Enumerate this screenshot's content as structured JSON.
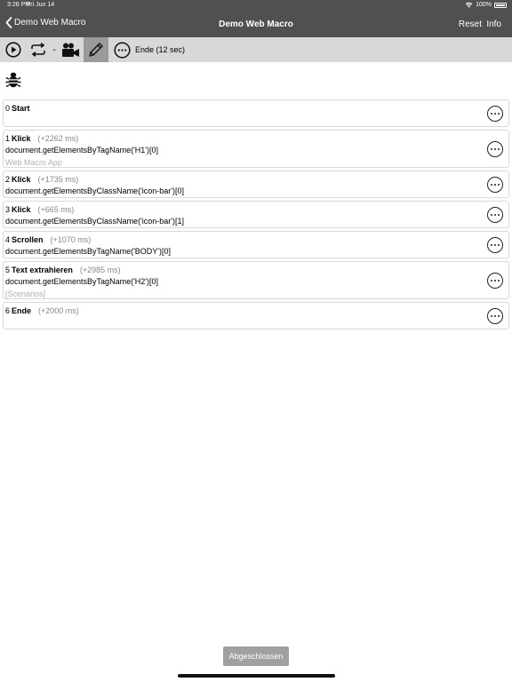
{
  "status_bar": {
    "time": "3:26 PM",
    "date": "Fri Jun 14",
    "battery": "100%"
  },
  "nav": {
    "back_label": "Demo Web Macro",
    "title": "Demo Web Macro",
    "reset_label": "Reset",
    "info_label": "Info"
  },
  "toolbar": {
    "dash": "-",
    "status": "Ende (12 sec)"
  },
  "steps": [
    {
      "number": "0",
      "name": "Start",
      "delay": "",
      "selector": "",
      "note": ""
    },
    {
      "number": "1",
      "name": "Klick",
      "delay": "(+2262 ms)",
      "selector": "document.getElementsByTagName('H1')[0]",
      "note": "Web Macro App"
    },
    {
      "number": "2",
      "name": "Klick",
      "delay": "(+1735 ms)",
      "selector": "document.getElementsByClassName('icon-bar')[0]",
      "note": ""
    },
    {
      "number": "3",
      "name": "Klick",
      "delay": "(+665 ms)",
      "selector": "document.getElementsByClassName('icon-bar')[1]",
      "note": ""
    },
    {
      "number": "4",
      "name": "Scrollen",
      "delay": "(+1070 ms)",
      "selector": "document.getElementsByTagName('BODY')[0]",
      "note": ""
    },
    {
      "number": "5",
      "name": "Text extrahieren",
      "delay": "(+2985 ms)",
      "selector": "document.getElementsByTagName('H2')[0]",
      "note": "[Scenarios]"
    },
    {
      "number": "6",
      "name": "Ende",
      "delay": "(+2000 ms)",
      "selector": "",
      "note": ""
    }
  ],
  "bottom_button": "Abgeschlossen"
}
